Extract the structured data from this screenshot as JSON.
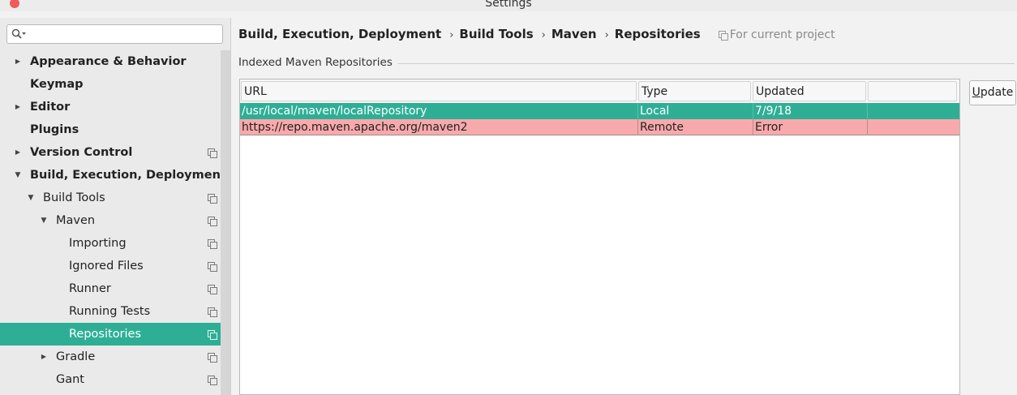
{
  "window": {
    "title": "Settings"
  },
  "search": {
    "placeholder": "",
    "value": ""
  },
  "sidebar": {
    "items": [
      {
        "label": "Appearance & Behavior",
        "bold": true,
        "arrow": "right",
        "copy": false
      },
      {
        "label": "Keymap",
        "bold": true,
        "arrow": "none",
        "copy": false
      },
      {
        "label": "Editor",
        "bold": true,
        "arrow": "right",
        "copy": false
      },
      {
        "label": "Plugins",
        "bold": true,
        "arrow": "none",
        "copy": false
      },
      {
        "label": "Version Control",
        "bold": true,
        "arrow": "right",
        "copy": true
      },
      {
        "label": "Build, Execution, Deployment",
        "bold": true,
        "arrow": "down",
        "copy": false
      },
      {
        "label": "Build Tools",
        "bold": false,
        "arrow": "down",
        "copy": true
      },
      {
        "label": "Maven",
        "bold": false,
        "arrow": "down",
        "copy": true
      },
      {
        "label": "Importing",
        "bold": false,
        "arrow": "none",
        "copy": true
      },
      {
        "label": "Ignored Files",
        "bold": false,
        "arrow": "none",
        "copy": true
      },
      {
        "label": "Runner",
        "bold": false,
        "arrow": "none",
        "copy": true
      },
      {
        "label": "Running Tests",
        "bold": false,
        "arrow": "none",
        "copy": true
      },
      {
        "label": "Repositories",
        "bold": false,
        "arrow": "none",
        "copy": true,
        "selected": true
      },
      {
        "label": "Gradle",
        "bold": false,
        "arrow": "right",
        "copy": true
      },
      {
        "label": "Gant",
        "bold": false,
        "arrow": "none",
        "copy": true
      }
    ]
  },
  "breadcrumb": {
    "items": [
      "Build, Execution, Deployment",
      "Build Tools",
      "Maven",
      "Repositories"
    ],
    "separator": "›",
    "scope_note": "For current project"
  },
  "section": {
    "title": "Indexed Maven Repositories"
  },
  "table": {
    "headers": [
      "URL",
      "Type",
      "Updated",
      ""
    ],
    "rows": [
      {
        "url": "/usr/local/maven/localRepository",
        "type": "Local",
        "updated": "7/9/18",
        "status": "ok"
      },
      {
        "url": "https://repo.maven.apache.org/maven2",
        "type": "Remote",
        "updated": "Error",
        "status": "error"
      }
    ]
  },
  "buttons": {
    "update_label_first": "U",
    "update_label_rest": "pdate"
  },
  "colors": {
    "selection": "#2eaf95",
    "error_row": "#f8a9ab",
    "close_button": "#ef5a5a"
  }
}
